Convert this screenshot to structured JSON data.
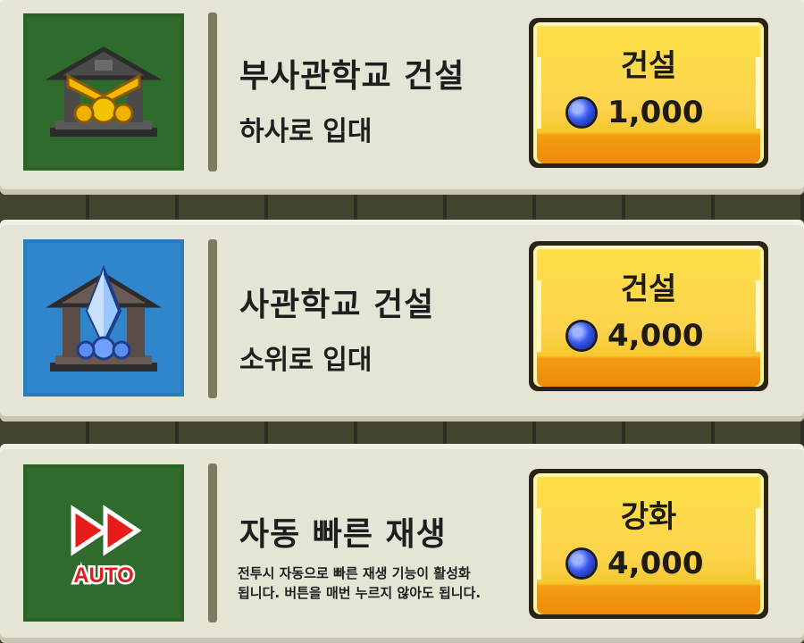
{
  "colors": {
    "card_bg": "#e6e4d5",
    "icon_green": "#2f6b2c",
    "icon_blue": "#2f86cc",
    "button_yellow": "#fcd34d",
    "button_orange": "#f39c12",
    "gem_blue": "#3b5bf0"
  },
  "items": [
    {
      "title": "부사관학교 건설",
      "subtitle": "하사로 입대",
      "button_label": "건설",
      "price": "1,000",
      "icon": "gold-academy-building-icon"
    },
    {
      "title": "사관학교 건설",
      "subtitle": "소위로 입대",
      "button_label": "건설",
      "price": "4,000",
      "icon": "crystal-academy-building-icon"
    },
    {
      "title": "자동 빠른 재생",
      "desc_line1": "전투시 자동으로 빠른 재생 기능이 활성화",
      "desc_line2": "됩니다. 버튼을 매번 누르지 않아도 됩니다.",
      "button_label": "강화",
      "price": "4,000",
      "icon": "auto-fast-forward-icon",
      "icon_text": "AUTO"
    }
  ]
}
